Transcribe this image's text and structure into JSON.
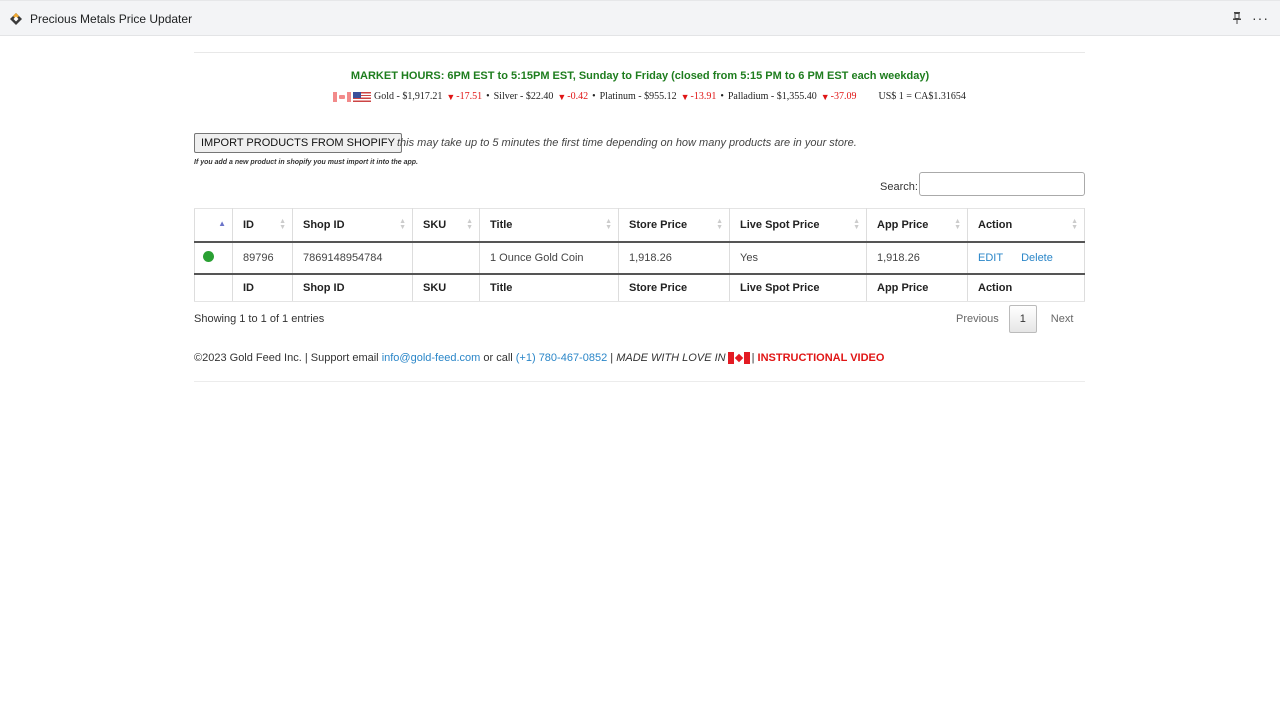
{
  "window": {
    "title": "Precious Metals Price Updater",
    "pin_icon": "pin-icon",
    "more_icon": "more-icon",
    "more_glyph": "···"
  },
  "market": {
    "hours": "MARKET HOURS: 6PM EST to 5:15PM EST, Sunday to Friday (closed from 5:15 PM to 6 PM EST each weekday)",
    "metals": [
      {
        "label": "Gold - $1,917.21",
        "change": "-17.51"
      },
      {
        "label": "Silver - $22.40",
        "change": "-0.42"
      },
      {
        "label": "Platinum - $955.12",
        "change": "-13.91"
      },
      {
        "label": "Palladium - $1,355.40",
        "change": "-37.09"
      }
    ],
    "down_arrow": "▼",
    "bullet": "•",
    "exchange_rate": "US$ 1 = CA$1.31654",
    "colors": {
      "hours": "#1e7d1e",
      "down": "#e01515"
    }
  },
  "import": {
    "button_label": "IMPORT PRODUCTS FROM SHOPIFY",
    "note": "this may take up to 5 minutes the first time depending on how many products are in your store.",
    "small_note": "If you add a new product in shopify you must import it into the app."
  },
  "search": {
    "label": "Search:",
    "value": "",
    "placeholder": ""
  },
  "table": {
    "columns": [
      "",
      "ID",
      "Shop ID",
      "SKU",
      "Title",
      "Store Price",
      "Live Spot Price",
      "App Price",
      "Action"
    ],
    "rows": [
      {
        "status": "active",
        "id": "89796",
        "shop_id": "7869148954784",
        "sku": "",
        "title": "1 Ounce Gold Coin",
        "store_price": "1,918.26",
        "live_spot_price": "Yes",
        "app_price": "1,918.26",
        "actions": [
          "EDIT",
          "Delete"
        ]
      }
    ],
    "status_color": "#2aa033"
  },
  "pagination": {
    "info": "Showing 1 to 1 of 1 entries",
    "previous": "Previous",
    "current_page": "1",
    "next": "Next"
  },
  "footer": {
    "copyright": "©2023 Gold Feed Inc. | Support email",
    "email": "info@gold-feed.com",
    "or_call": "or call",
    "phone": "(+1) 780-467-0852",
    "sep1": "|",
    "made_with_love": "MADE WITH LOVE IN",
    "sep2": "|",
    "video": "INSTRUCTIONAL VIDEO"
  }
}
